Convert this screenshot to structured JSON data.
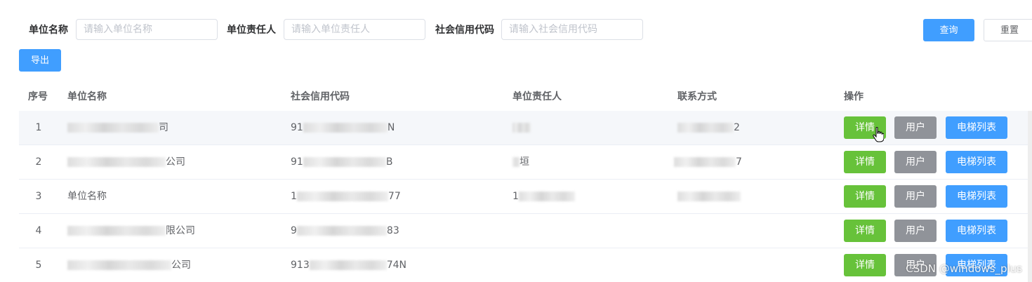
{
  "search": {
    "unit_name_label": "单位名称",
    "unit_name_placeholder": "请输入单位名称",
    "owner_label": "单位责任人",
    "owner_placeholder": "请输入单位责任人",
    "credit_label": "社会信用代码",
    "credit_placeholder": "请输入社会信用代码",
    "query_button": "查询",
    "reset_button": "重置",
    "export_button": "导出"
  },
  "table": {
    "headers": {
      "index": "序号",
      "unit_name": "单位名称",
      "credit_code": "社会信用代码",
      "owner": "单位责任人",
      "contact": "联系方式",
      "actions": "操作"
    },
    "rows": [
      {
        "index": "1",
        "name_visible": "司",
        "code_prefix": "91",
        "code_suffix": "N",
        "owner_suffix": "",
        "contact_suffix": "2"
      },
      {
        "index": "2",
        "name_visible": "公司",
        "code_prefix": "91",
        "code_suffix": "B",
        "owner_suffix": "垣",
        "contact_suffix": "7"
      },
      {
        "index": "3",
        "name_visible": "单位名称",
        "code_prefix": "1",
        "code_suffix": "77",
        "owner_suffix": "",
        "contact_suffix": ""
      },
      {
        "index": "4",
        "name_visible": "限公司",
        "code_prefix": "9",
        "code_suffix": "83",
        "owner_suffix": "",
        "contact_suffix": ""
      },
      {
        "index": "5",
        "name_visible": "公司",
        "code_prefix": "913",
        "code_suffix": "74N",
        "owner_suffix": "",
        "contact_suffix": ""
      }
    ],
    "action_labels": {
      "detail": "详情",
      "user": "用户",
      "elevator_list": "电梯列表"
    }
  },
  "watermark": "CSDN @windows_plus",
  "colors": {
    "primary": "#409eff",
    "success": "#67c23a",
    "info": "#909399",
    "row_hover": "#f5f7fa"
  }
}
